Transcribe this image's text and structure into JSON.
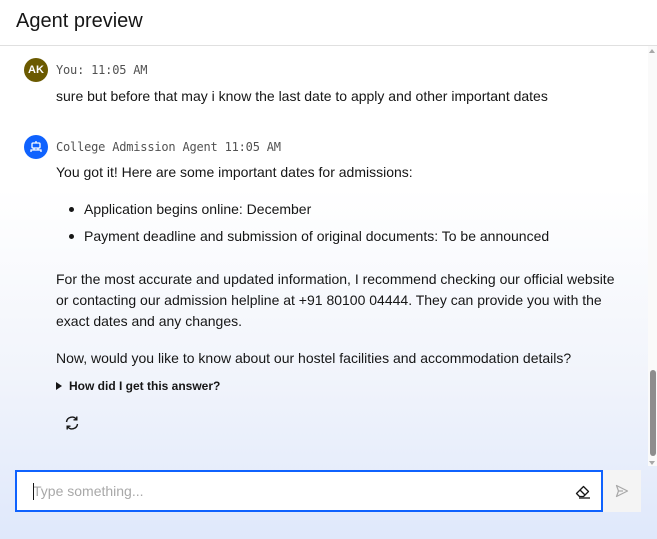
{
  "header": {
    "title": "Agent preview"
  },
  "user_message": {
    "avatar_initials": "AK",
    "meta": "You: 11:05 AM",
    "text": "sure but before that may i know the last date to apply and other important dates"
  },
  "agent_message": {
    "avatar_icon": "robot-icon",
    "meta": "College Admission Agent 11:05 AM",
    "intro": "You got it! Here are some important dates for admissions:",
    "bullets": [
      "Application begins online: December",
      "Payment deadline and submission of original documents: To be announced"
    ],
    "paragraph1": "For the most accurate and updated information, I recommend checking our official website or contacting our admission helpline at +91 80100 04444. They can provide you with the exact dates and any changes.",
    "paragraph2": "Now, would you like to know about our hostel facilities and accommodation details?",
    "disclosure_label": "How did I get this answer?"
  },
  "composer": {
    "placeholder": "Type something..."
  },
  "colors": {
    "accent": "#0f62fe",
    "user_avatar": "#6b5a00"
  }
}
